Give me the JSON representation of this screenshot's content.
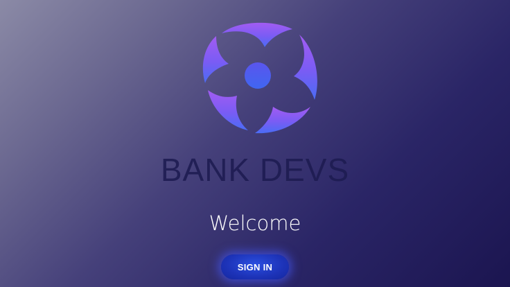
{
  "brand": {
    "name": "BANK DEVS",
    "logo_icon": "bank-devs-logo-icon",
    "logo_colors": {
      "top": "#8f5bf4",
      "bottom": "#4a6cf5",
      "accent": "#4d63f2"
    }
  },
  "welcome": {
    "text": "Welcome"
  },
  "actions": {
    "sign_in_label": "SIGN IN",
    "sign_in_color": "#1d33b8"
  }
}
